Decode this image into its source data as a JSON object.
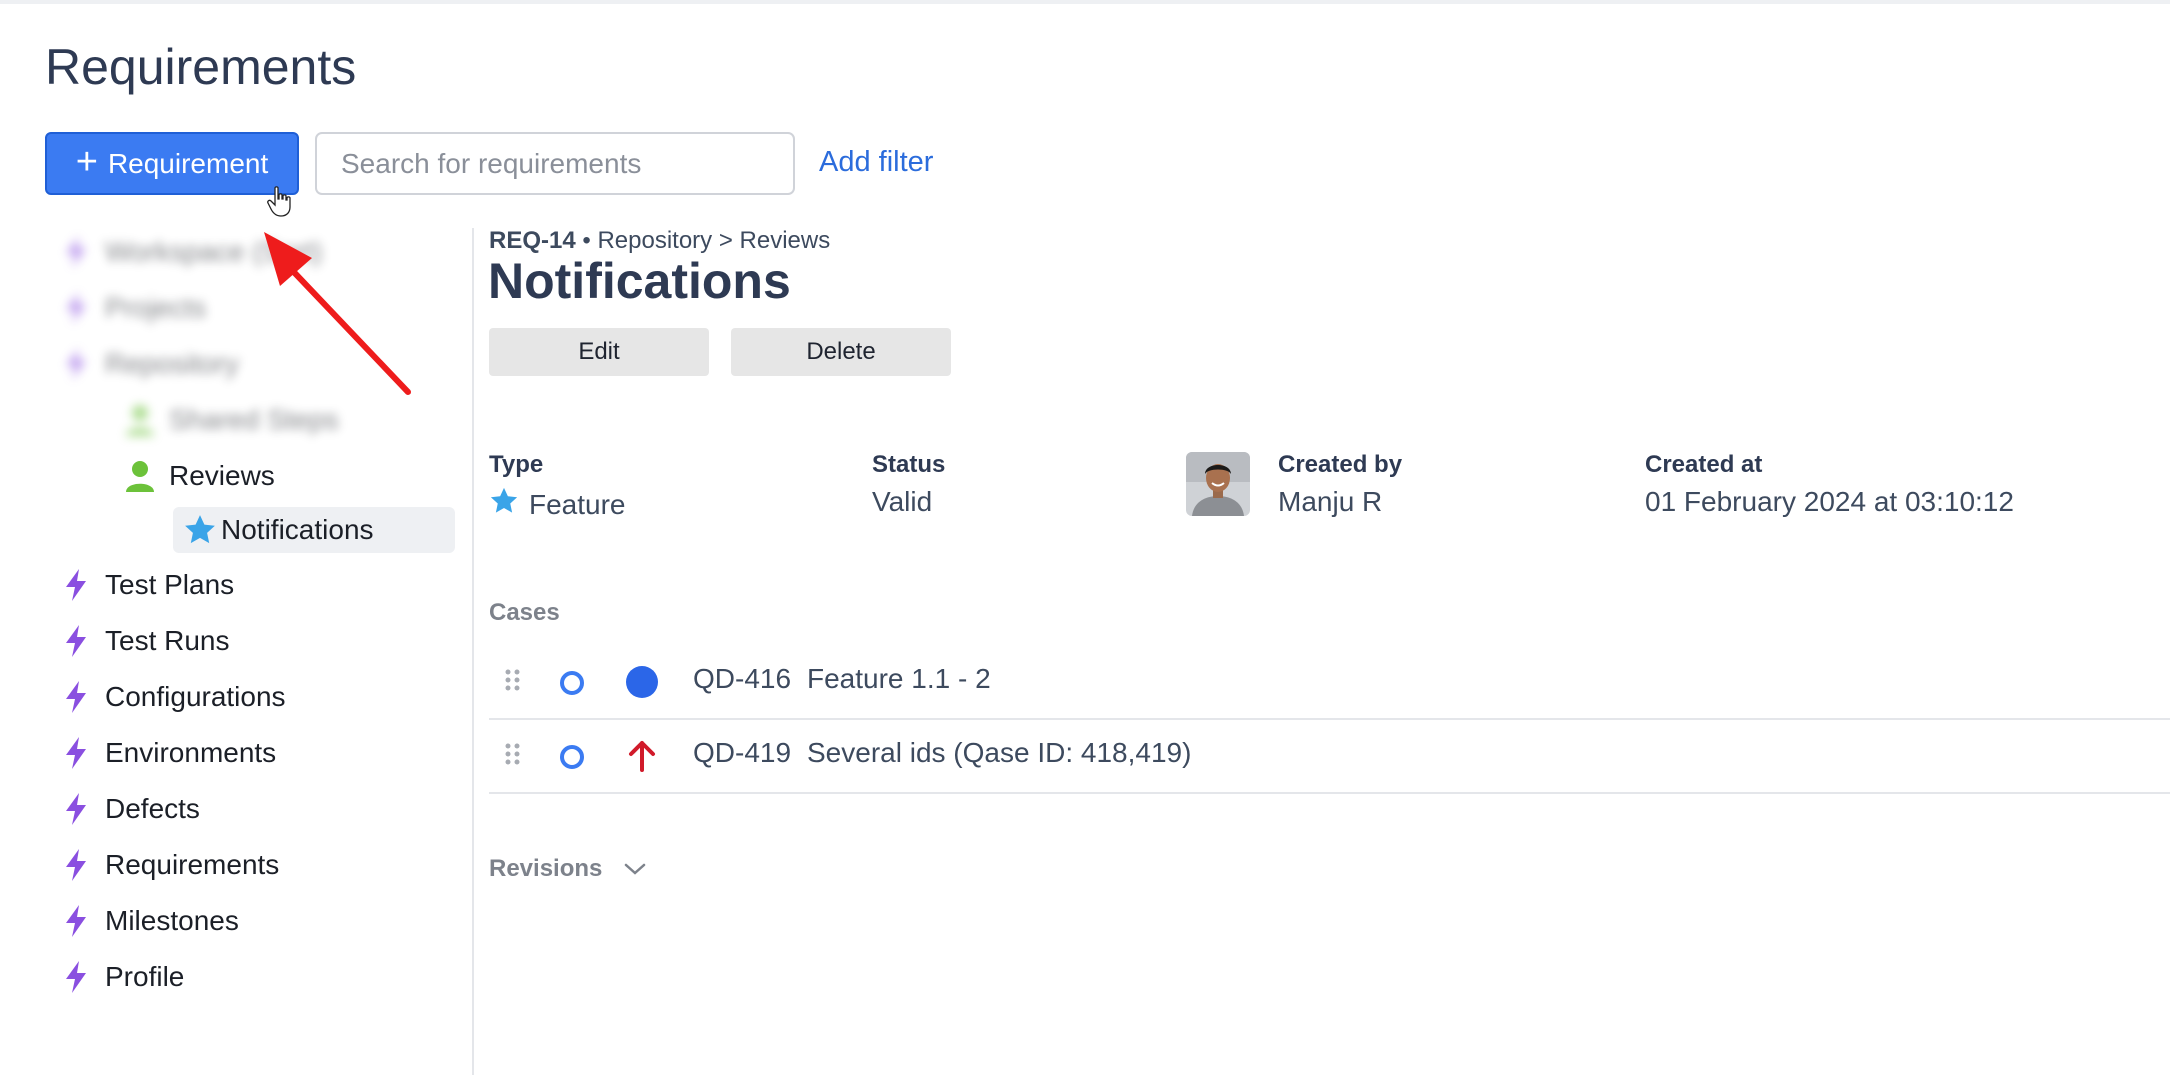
{
  "page": {
    "title": "Requirements"
  },
  "toolbar": {
    "new_label": "Requirement",
    "search_placeholder": "Search for requirements",
    "add_filter_label": "Add filter"
  },
  "sidebar": {
    "items": [
      {
        "label": "Workspace (Sort)",
        "icon": "bolt-icon",
        "blurred": true
      },
      {
        "label": "Projects",
        "icon": "bolt-icon",
        "blurred": true
      },
      {
        "label": "Repository",
        "icon": "bolt-icon",
        "blurred": true
      },
      {
        "label": "Shared Steps",
        "icon": "user-icon",
        "blurred": true
      },
      {
        "label": "Reviews",
        "icon": "user-icon"
      },
      {
        "label": "Notifications",
        "icon": "star-icon",
        "active": true
      },
      {
        "label": "Test Plans",
        "icon": "bolt-icon"
      },
      {
        "label": "Test Runs",
        "icon": "bolt-icon"
      },
      {
        "label": "Configurations",
        "icon": "bolt-icon"
      },
      {
        "label": "Environments",
        "icon": "bolt-icon"
      },
      {
        "label": "Defects",
        "icon": "bolt-icon"
      },
      {
        "label": "Requirements",
        "icon": "bolt-icon"
      },
      {
        "label": "Milestones",
        "icon": "bolt-icon"
      },
      {
        "label": "Profile",
        "icon": "bolt-icon"
      }
    ]
  },
  "detail": {
    "id": "REQ-14",
    "breadcrumb": "Repository > Reviews",
    "title": "Notifications",
    "edit_label": "Edit",
    "delete_label": "Delete",
    "type_label": "Type",
    "type_value": "Feature",
    "status_label": "Status",
    "status_value": "Valid",
    "created_by_label": "Created by",
    "created_by_value": "Manju R",
    "created_at_label": "Created at",
    "created_at_value": "01 February 2024 at 03:10:12",
    "cases_label": "Cases",
    "revisions_label": "Revisions",
    "cases": [
      {
        "id": "QD-416",
        "title": "Feature 1.1 - 2",
        "priority_icon": "blue-circle-icon"
      },
      {
        "id": "QD-419",
        "title": "Several ids (Qase ID: 418,419)",
        "priority_icon": "red-arrow-up-icon"
      }
    ]
  },
  "colors": {
    "primary": "#3b7bf2",
    "bolt": "#8a4fe0",
    "user": "#6cc23a",
    "star": "#3aa4e8",
    "annotation": "#ee1c1c",
    "priority_high": "#d11a2a"
  }
}
